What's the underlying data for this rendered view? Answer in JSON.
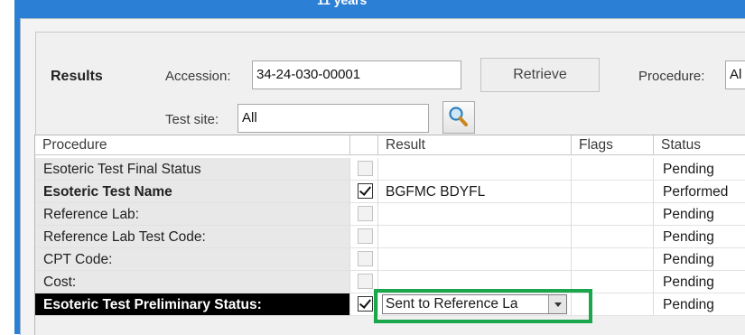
{
  "window": {
    "title_fragment": "11 years"
  },
  "form": {
    "results_label": "Results",
    "accession_label": "Accession:",
    "accession_value": "34-24-030-00001",
    "retrieve_label": "Retrieve",
    "procedure_label": "Procedure:",
    "procedure_value": "Al",
    "test_site_label": "Test site:",
    "test_site_value": "All",
    "search_icon": "magnifier-icon"
  },
  "grid": {
    "headers": [
      "Procedure",
      "",
      "Result",
      "Flags",
      "Status"
    ],
    "rows": [
      {
        "procedure": "Esoteric Test Final Status",
        "checked": false,
        "result": "",
        "flags": "",
        "status": "Pending"
      },
      {
        "procedure": "Esoteric Test Name",
        "checked": true,
        "result": "BGFMC BDYFL",
        "flags": "",
        "status": "Performed"
      },
      {
        "procedure": "Reference Lab:",
        "checked": false,
        "result": "",
        "flags": "",
        "status": "Pending"
      },
      {
        "procedure": "Reference Lab Test Code:",
        "checked": false,
        "result": "",
        "flags": "",
        "status": "Pending"
      },
      {
        "procedure": "CPT Code:",
        "checked": false,
        "result": "",
        "flags": "",
        "status": "Pending"
      },
      {
        "procedure": "Cost:",
        "checked": false,
        "result": "",
        "flags": "",
        "status": "Pending"
      },
      {
        "procedure": "Esoteric Test Preliminary Status:",
        "checked": true,
        "result": "Sent to Reference La",
        "flags": "",
        "status": "Pending"
      }
    ]
  },
  "colors": {
    "frame_blue": "#2b7fd4",
    "highlight_green": "#1aa64a",
    "selected_row_bg": "#000000"
  }
}
